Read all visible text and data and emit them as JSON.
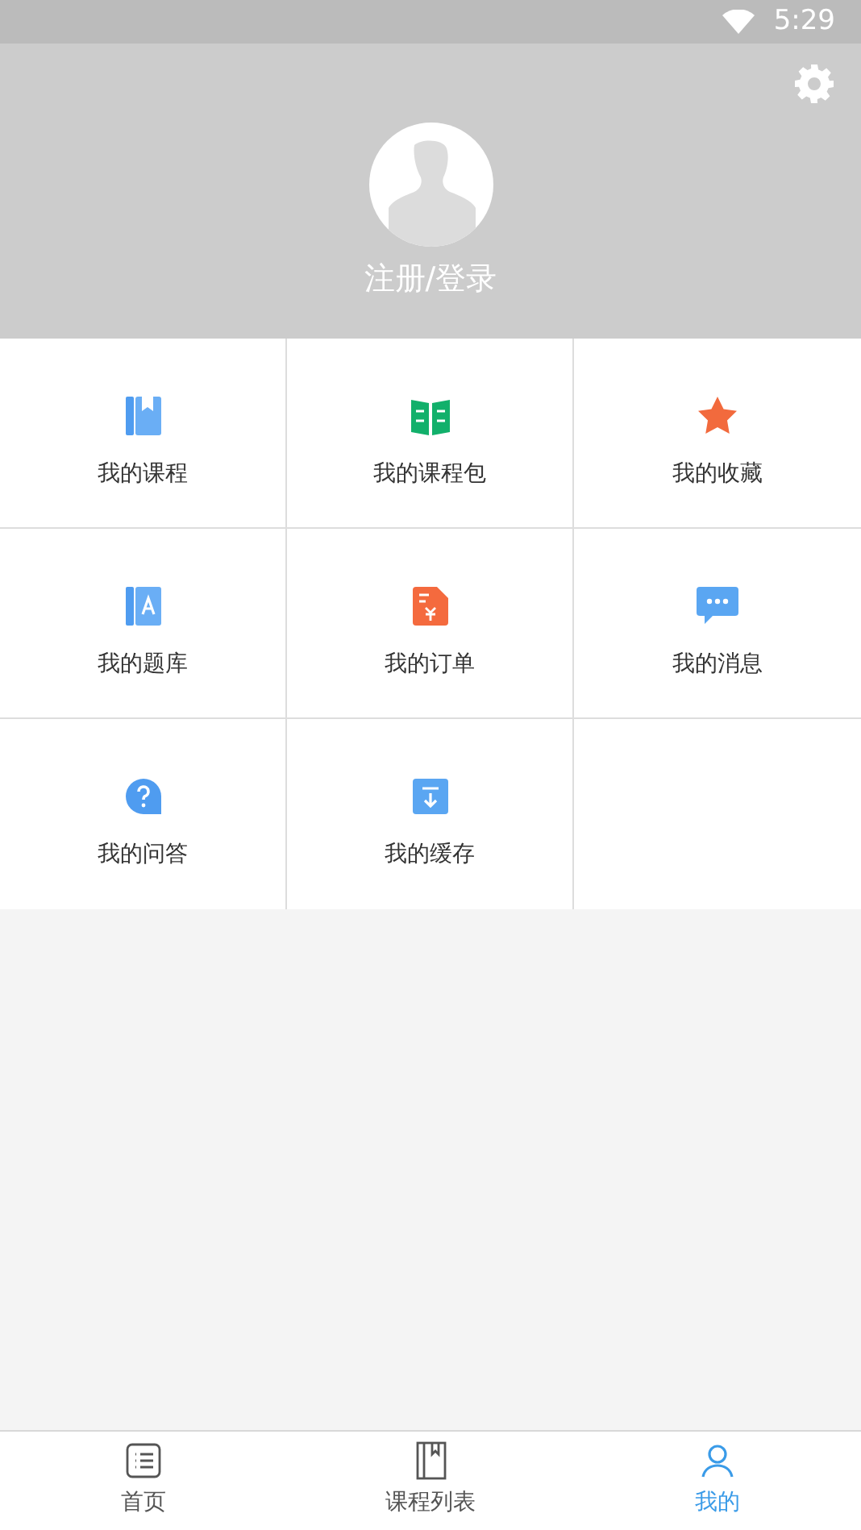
{
  "status_bar": {
    "time": "5:29"
  },
  "profile": {
    "login_label": "注册/登录"
  },
  "menu": [
    {
      "kind": "course",
      "label": "我的课程"
    },
    {
      "kind": "package",
      "label": "我的课程包"
    },
    {
      "kind": "favorite",
      "label": "我的收藏"
    },
    {
      "kind": "quiz",
      "label": "我的题库"
    },
    {
      "kind": "order",
      "label": "我的订单"
    },
    {
      "kind": "message",
      "label": "我的消息"
    },
    {
      "kind": "qa",
      "label": "我的问答"
    },
    {
      "kind": "cache",
      "label": "我的缓存"
    }
  ],
  "tabs": [
    {
      "kind": "home",
      "label": "首页",
      "selected": false
    },
    {
      "kind": "courses",
      "label": "课程列表",
      "selected": false
    },
    {
      "kind": "me",
      "label": "我的",
      "selected": true
    }
  ]
}
